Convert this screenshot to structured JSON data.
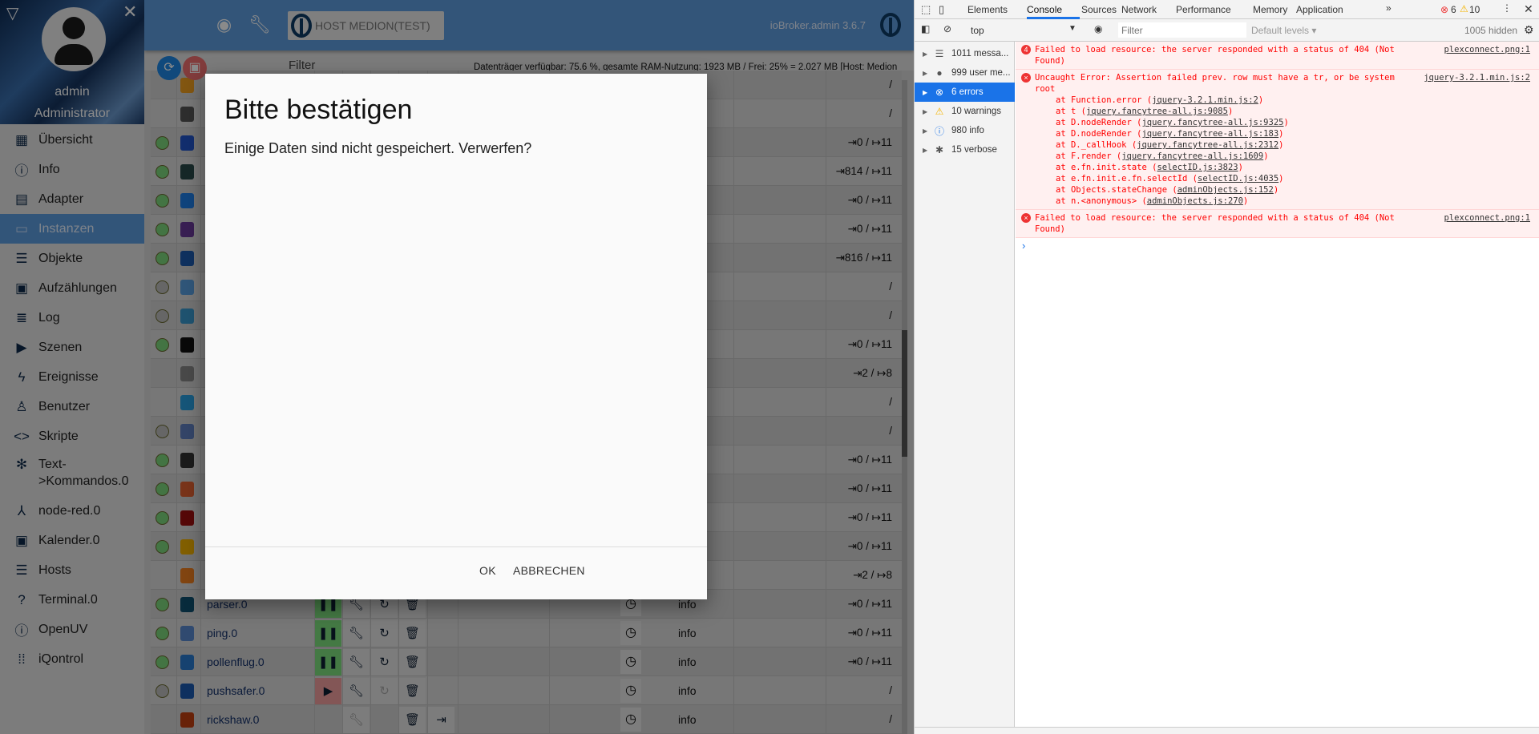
{
  "sidebar": {
    "user": "admin",
    "role": "Administrator",
    "items": [
      {
        "label": "Übersicht",
        "icon": "grid-icon",
        "glyph": "▦"
      },
      {
        "label": "Info",
        "icon": "info-icon",
        "glyph": "ⓘ"
      },
      {
        "label": "Adapter",
        "icon": "store-icon",
        "glyph": "▤"
      },
      {
        "label": "Instanzen",
        "icon": "instances-icon",
        "glyph": "▭",
        "active": true
      },
      {
        "label": "Objekte",
        "icon": "list-icon",
        "glyph": "☰"
      },
      {
        "label": "Aufzählungen",
        "icon": "enum-icon",
        "glyph": "▣"
      },
      {
        "label": "Log",
        "icon": "log-icon",
        "glyph": "≣"
      },
      {
        "label": "Szenen",
        "icon": "scenes-icon",
        "glyph": "▶"
      },
      {
        "label": "Ereignisse",
        "icon": "flash-icon",
        "glyph": "ϟ"
      },
      {
        "label": "Benutzer",
        "icon": "user-icon",
        "glyph": "♙"
      },
      {
        "label": "Skripte",
        "icon": "code-icon",
        "glyph": "<>"
      },
      {
        "label": "Text->Kommandos.0",
        "label1": "Text-",
        "label2": ">Kommandos.0",
        "icon": "snowflake-icon",
        "glyph": "✻",
        "two": true
      },
      {
        "label": "node-red.0",
        "icon": "node-red-icon",
        "glyph": "⅄"
      },
      {
        "label": "Kalender.0",
        "icon": "calendar-icon",
        "glyph": "▣"
      },
      {
        "label": "Hosts",
        "icon": "hosts-icon",
        "glyph": "☰"
      },
      {
        "label": "Terminal.0",
        "icon": "terminal-icon",
        "glyph": "?"
      },
      {
        "label": "OpenUV",
        "icon": "info-icon",
        "glyph": "ⓘ"
      },
      {
        "label": "iQontrol",
        "icon": "iqontrol-icon",
        "glyph": "⁞⁞"
      }
    ]
  },
  "header": {
    "host_button": "HOST MEDION(TEST)",
    "version": "ioBroker.admin 3.6.7"
  },
  "toolbar": {
    "filter_label": "Filter",
    "disk_info": "Datenträger verfügbar: 75.6 %, gesamte RAM-Nutzung: 1923 MB / Frei: 25% = 2.027 MB [Host: Medion"
  },
  "instances": [
    {
      "status": "none",
      "icon_color": "#f0a020",
      "name": "",
      "value": "/"
    },
    {
      "status": "none",
      "icon_color": "#555555",
      "name": "",
      "value": "/"
    },
    {
      "status": "green",
      "icon_color": "#2255cc",
      "name": "",
      "value": "⇥0 / ↦11"
    },
    {
      "status": "green",
      "icon_color": "#2a4a4a",
      "name": "",
      "value": "⇥814 / ↦11"
    },
    {
      "status": "green",
      "icon_color": "#1e7ee8",
      "name": "",
      "value": "⇥0 / ↦11"
    },
    {
      "status": "green",
      "icon_color": "#6a3a9a",
      "name": "",
      "value": "⇥0 / ↦11"
    },
    {
      "status": "green",
      "icon_color": "#1d5cb0",
      "name": "",
      "value": "⇥816 / ↦11"
    },
    {
      "status": "grey",
      "icon_color": "#5aa0e0",
      "name": "",
      "value": "/"
    },
    {
      "status": "grey",
      "icon_color": "#3a9ad0",
      "name": "",
      "value": "/"
    },
    {
      "status": "green",
      "icon_color": "#111111",
      "name": "",
      "value": "⇥0 / ↦11"
    },
    {
      "status": "none",
      "icon_color": "#888888",
      "name": "",
      "value": "⇥2 / ↦8"
    },
    {
      "status": "none",
      "icon_color": "#2aa0e0",
      "name": "",
      "value": "/"
    },
    {
      "status": "grey",
      "icon_color": "#6080c0",
      "name": "",
      "value": "/"
    },
    {
      "status": "green",
      "icon_color": "#333333",
      "name": "",
      "value": "⇥0 / ↦11"
    },
    {
      "status": "green",
      "icon_color": "#e06030",
      "name": "",
      "value": "⇥0 / ↦11"
    },
    {
      "status": "green",
      "icon_color": "#a01010",
      "name": "",
      "value": "⇥0 / ↦11"
    },
    {
      "status": "green",
      "icon_color": "#f0b000",
      "name": "",
      "value": "⇥0 / ↦11"
    },
    {
      "status": "none",
      "icon_color": "#f08020",
      "name": "",
      "value": "⇥2 / ↦8"
    },
    {
      "status": "green",
      "icon_color": "#105070",
      "name": "parser.0",
      "state": "running",
      "restart": true,
      "log": "info",
      "value": "⇥0 / ↦11"
    },
    {
      "status": "green",
      "icon_color": "#5a8ad0",
      "name": "ping.0",
      "state": "running",
      "restart": true,
      "log": "info",
      "value": "⇥0 / ↦11"
    },
    {
      "status": "green",
      "icon_color": "#2a7ad0",
      "name": "pollenflug.0",
      "state": "running",
      "restart": true,
      "log": "info",
      "value": "⇥0 / ↦11"
    },
    {
      "status": "grey",
      "icon_color": "#1a5ab0",
      "name": "pushsafer.0",
      "state": "stopped",
      "restart": true,
      "log": "info",
      "value": "/"
    },
    {
      "status": "none",
      "icon_color": "#c04010",
      "name": "rickshaw.0",
      "state": "none",
      "restart": false,
      "upload": true,
      "log": "info",
      "value": "/"
    }
  ],
  "dialog": {
    "title": "Bitte bestätigen",
    "message": "Einige Daten sind nicht gespeichert. Verwerfen?",
    "ok": "OK",
    "cancel": "ABBRECHEN"
  },
  "devtools": {
    "tabs": [
      "Elements",
      "Console",
      "Sources",
      "Network",
      "Performance",
      "Memory",
      "Application"
    ],
    "active_tab": "Console",
    "error_count": "6",
    "warning_count": "10",
    "context": "top",
    "filter_placeholder": "Filter",
    "levels": "Default levels ▾",
    "hidden": "1005 hidden",
    "sidebar": [
      {
        "label": "1011 messa...",
        "glyph": "☰",
        "color": "#555"
      },
      {
        "label": "999 user me...",
        "glyph": "●",
        "color": "#555"
      },
      {
        "label": "6 errors",
        "glyph": "⊗",
        "color": "#fff",
        "selected": true
      },
      {
        "label": "10 warnings",
        "glyph": "⚠",
        "color": "#f4b400"
      },
      {
        "label": "980 info",
        "glyph": "ⓘ",
        "color": "#1a73e8"
      },
      {
        "label": "15 verbose",
        "glyph": "✱",
        "color": "#555"
      }
    ],
    "messages": [
      {
        "badge": "4",
        "text": "Failed to load resource: the server responded with a status of 404 (Not Found)",
        "source": "plexconnect.png:1",
        "stack": []
      },
      {
        "badge": "×",
        "text": "Uncaught Error: Assertion failed prev. row must have a tr, or be system root",
        "source": "jquery-3.2.1.min.js:2",
        "stack": [
          {
            "at": "at Function.error (",
            "link": "jquery-3.2.1.min.js:2"
          },
          {
            "at": "at t (",
            "link": "jquery.fancytree-all.js:9085"
          },
          {
            "at": "at D.nodeRender (",
            "link": "jquery.fancytree-all.js:9325"
          },
          {
            "at": "at D.nodeRender (",
            "link": "jquery.fancytree-all.js:183"
          },
          {
            "at": "at D._callHook (",
            "link": "jquery.fancytree-all.js:2312"
          },
          {
            "at": "at F.render (",
            "link": "jquery.fancytree-all.js:1609"
          },
          {
            "at": "at e.fn.init.state (",
            "link": "selectID.js:3823"
          },
          {
            "at": "at e.fn.init.e.fn.selectId (",
            "link": "selectID.js:4035"
          },
          {
            "at": "at Objects.stateChange (",
            "link": "adminObjects.js:152"
          },
          {
            "at": "at n.<anonymous> (",
            "link": "adminObjects.js:270"
          }
        ]
      },
      {
        "badge": "×",
        "text": "Failed to load resource: the server responded with a status of 404 (Not Found)",
        "source": "plexconnect.png:1",
        "stack": []
      }
    ],
    "prompt": "›"
  },
  "colors": {
    "header": "#5e9ee0",
    "accent": "#1a73e8",
    "error": "#ff0000",
    "status_green": "#7cd67c",
    "status_grey": "#bdbdbd"
  }
}
